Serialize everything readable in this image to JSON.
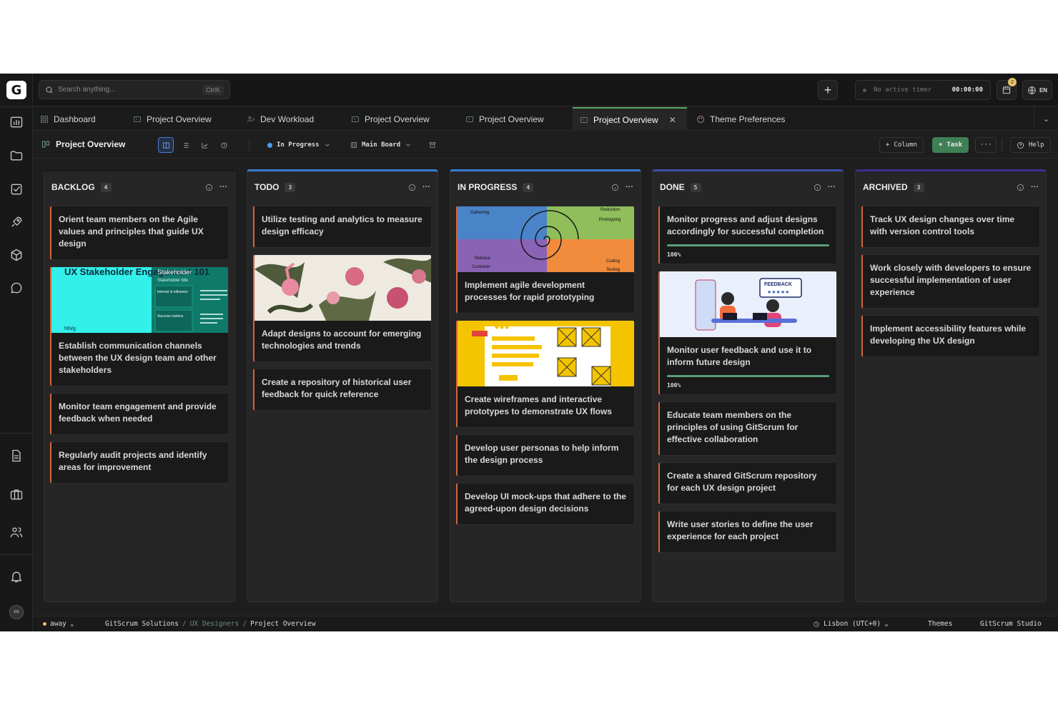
{
  "app": {
    "logo": "G"
  },
  "topbar": {
    "search_placeholder": "Search anything...",
    "search_shortcut": "CtrlK",
    "timer_label": "No active timer",
    "timer_value": "00:00:00",
    "notifications_count": "2",
    "language": "EN"
  },
  "tabs": [
    {
      "label": "Dashboard",
      "icon": "grid-icon"
    },
    {
      "label": "Project Overview",
      "icon": "folder-icon"
    },
    {
      "label": "Dev Workload",
      "icon": "users-icon"
    },
    {
      "label": "Project Overview",
      "icon": "folder-icon"
    },
    {
      "label": "Project Overview",
      "icon": "folder-icon"
    },
    {
      "label": "Project Overview",
      "icon": "folder-icon",
      "active": true
    },
    {
      "label": "Theme Preferences",
      "icon": "palette-icon"
    }
  ],
  "toolbar": {
    "title": "Project Overview",
    "status_filter": "In Progress",
    "board_select": "Main Board",
    "column_label": "Column",
    "task_label": "Task",
    "help_label": "Help"
  },
  "columns": [
    {
      "title": "BACKLOG",
      "count": "4",
      "accent": "#1a1a1a",
      "cards": [
        {
          "title": "Orient team members on the Agile values and principles that guide UX design"
        },
        {
          "title": "Establish communication channels between the UX design team and other stakeholders",
          "image": "stakeholder",
          "image_text": {
            "headline": "UX Stakeholder Engagement 101",
            "side_title": "Stakeholder",
            "side_sub": "Stakeholder title",
            "cell1": "Interest & influence",
            "cell2": "Success metrics",
            "brand": "NN/g"
          }
        },
        {
          "title": "Monitor team engagement and provide feedback when needed"
        },
        {
          "title": "Regularly audit projects and identify areas for improvement"
        }
      ]
    },
    {
      "title": "TODO",
      "count": "3",
      "accent": "#3a7bd5",
      "cards": [
        {
          "title": "Utilize testing and analytics to measure design efficacy"
        },
        {
          "title": "Adapt designs to account for emerging technologies and trends",
          "image": "flamingo"
        },
        {
          "title": "Create a repository of historical user feedback for quick reference"
        }
      ]
    },
    {
      "title": "IN PROGRESS",
      "count": "4",
      "accent": "#3a7bd5",
      "cards": [
        {
          "title": "Implement agile development processes for rapid prototyping",
          "image": "spiral",
          "image_text": {
            "q1": "Gathering",
            "q2": "Reduction",
            "q2b": "Prototyping",
            "q3": "Release",
            "q3b": "Customer",
            "q4": "Coding",
            "q4b": "Testing"
          }
        },
        {
          "title": "Create wireframes and interactive prototypes to demonstrate UX flows",
          "image": "wireframe"
        },
        {
          "title": "Develop user personas to help inform the design process"
        },
        {
          "title": "Develop UI mock-ups that adhere to the agreed-upon design decisions"
        }
      ]
    },
    {
      "title": "DONE",
      "count": "5",
      "accent": "#3a4fa5",
      "cards": [
        {
          "title": "Monitor progress and adjust designs accordingly for successful completion",
          "progress": 1.0,
          "progress_label": "100%"
        },
        {
          "title": "Monitor user feedback and use it to inform future design",
          "image": "feedback",
          "image_text": {
            "banner": "FEEDBACK"
          },
          "progress": 1.0,
          "progress_label": "100%"
        },
        {
          "title": "Educate team members on the principles of using GitScrum for effective collaboration"
        },
        {
          "title": "Create a shared GitScrum repository for each UX design project"
        },
        {
          "title": "Write user stories to define the user experience for each project"
        }
      ]
    },
    {
      "title": "ARCHIVED",
      "count": "3",
      "accent": "#3b2f8f",
      "cards": [
        {
          "title": "Track UX design changes over time with version control tools"
        },
        {
          "title": "Work closely with developers to ensure successful implementation of user experience"
        },
        {
          "title": "Implement accessibility features while developing the UX design"
        }
      ]
    }
  ],
  "statusbar": {
    "presence": "away",
    "org": "GitScrum Solutions",
    "team": "UX Designers",
    "page": "Project Overview",
    "timezone": "Lisbon (UTC+0)",
    "themes": "Themes",
    "studio": "GitScrum Studio"
  },
  "colors": {
    "card_border": "#d4653a",
    "progress": "#5a9e7a",
    "active_tab": "#5fa36a",
    "task_button": "#3f7f55"
  }
}
